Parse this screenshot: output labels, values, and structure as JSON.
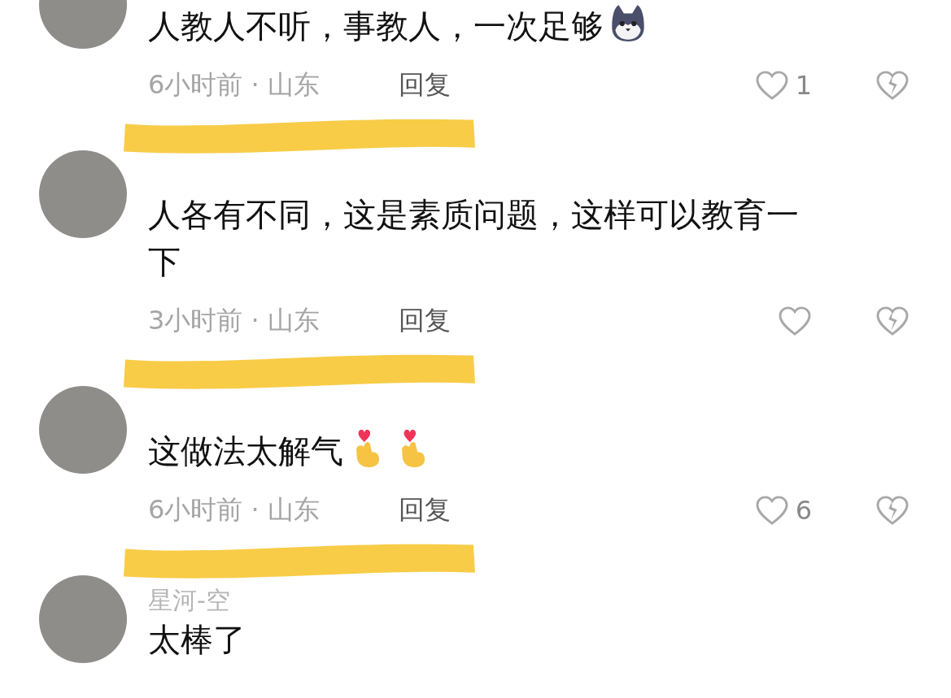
{
  "comments": [
    {
      "text": "人教人不听，事教人，一次足够",
      "stickers": [
        {
          "kind": "dog"
        }
      ],
      "meta": "6小时前 · 山东",
      "reply": "回复",
      "likes": "1"
    },
    {
      "redacted": true,
      "text": "人各有不同，这是素质问题，这样可以教育一下",
      "meta": "3小时前 · 山东",
      "reply": "回复"
    },
    {
      "redacted": true,
      "text": "这做法太解气",
      "stickers": [
        {
          "kind": "heart-hand"
        },
        {
          "kind": "heart-hand"
        }
      ],
      "meta": "6小时前 · 山东",
      "reply": "回复",
      "likes": "6"
    },
    {
      "redacted": true,
      "username": "星河-空",
      "text": "太棒了"
    }
  ]
}
